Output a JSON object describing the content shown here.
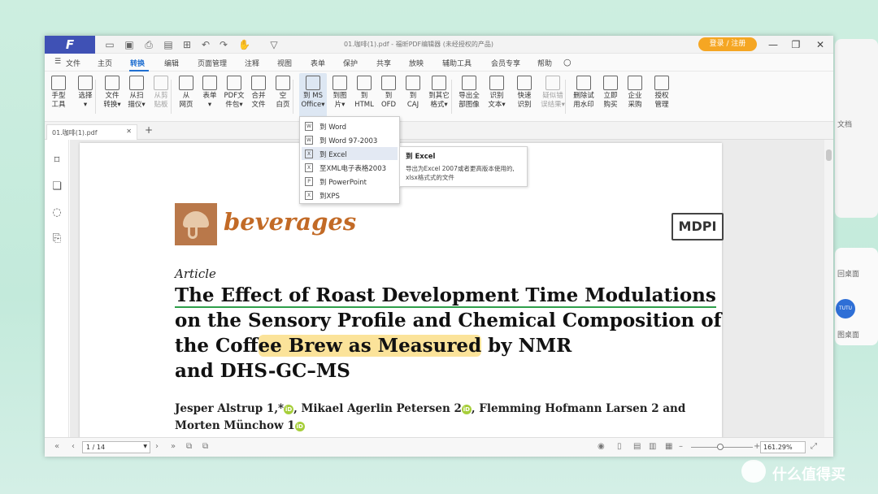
{
  "titlebar": {
    "doc_title": "01.咖啡(1).pdf - 福昕PDF编辑器 (未经授权的产品)",
    "login": "登录 / 注册",
    "logo": "F"
  },
  "menu": [
    "文件",
    "主页",
    "转换",
    "编辑",
    "页面管理",
    "注释",
    "视图",
    "表单",
    "保护",
    "共享",
    "放映",
    "辅助工具",
    "会员专享",
    "帮助"
  ],
  "menu_active": "转换",
  "ribbon": [
    {
      "l": "手型\n工具"
    },
    {
      "l": "选择\n▾"
    },
    {
      "l": "文件\n转换▾"
    },
    {
      "l": "从扫\n描仪▾"
    },
    {
      "l": "从剪\n贴板",
      "dim": true
    },
    {
      "l": "从\n网页"
    },
    {
      "l": "表单\n▾"
    },
    {
      "l": "PDF文\n件包▾"
    },
    {
      "l": "合并\n文件"
    },
    {
      "l": "空\n白页"
    },
    {
      "l": "到 MS\nOffice▾",
      "sel": true
    },
    {
      "l": "到图\n片▾"
    },
    {
      "l": "到\nHTML"
    },
    {
      "l": "到\nOFD"
    },
    {
      "l": "到\nCAJ"
    },
    {
      "l": "到其它\n格式▾"
    },
    {
      "l": "导出全\n部图像"
    },
    {
      "l": "识别\n文本▾"
    },
    {
      "l": "快速\n识别"
    },
    {
      "l": "疑似错\n误结果▾",
      "dim": true
    },
    {
      "l": "删除试\n用水印"
    },
    {
      "l": "立即\n购买"
    },
    {
      "l": "企业\n采购"
    },
    {
      "l": "授权\n管理"
    }
  ],
  "tab": {
    "name": "01.咖啡(1).pdf",
    "close": "✕",
    "add": "+"
  },
  "dropdown": [
    {
      "label": "到 Word",
      "icon": "W"
    },
    {
      "label": "到 Word 97-2003",
      "icon": "W"
    },
    {
      "label": "到 Excel",
      "icon": "X",
      "highlight": true
    },
    {
      "label": "至XML电子表格2003",
      "icon": "X"
    },
    {
      "label": "到 PowerPoint",
      "icon": "P"
    },
    {
      "label": "到XPS",
      "icon": "X"
    }
  ],
  "tooltip": {
    "title": "到 Excel",
    "body1": "导出为Excel 2007或者更高版本使用的,",
    "body2": "xlsx格式式的文件"
  },
  "doc": {
    "journal": "beverages",
    "publisher": "MDPI",
    "type": "Article",
    "title_l1": "The Effect of Roast Development Time Modulations",
    "title_l2": "on the Sensory Profile and Chemical Composition of",
    "title_l3a": "the Coff",
    "title_l3b": "ee Brew as Measured",
    "title_l3c": " by NMR",
    "title_l4": "and DHS-GC–MS",
    "authors_l1": "Jesper Alstrup 1,*",
    "authors_l1b": ", Mikael Agerlin Petersen 2",
    "authors_l1c": ", Flemming Hofmann Larsen 2 and",
    "authors_l2": "Morten Münchow 1"
  },
  "status": {
    "page": "1 / 14",
    "zoom": "161.29%"
  },
  "desktop": {
    "side1": "文档",
    "side2": "回桌面",
    "side3": "图桌面",
    "watermark": "什么值得买"
  }
}
